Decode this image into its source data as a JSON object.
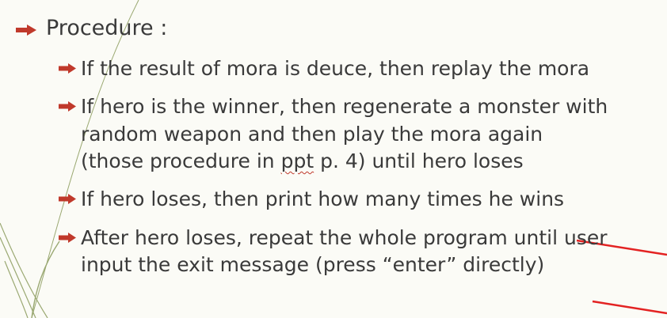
{
  "slide": {
    "heading": "Procedure :",
    "bullets": [
      {
        "lines": [
          "If the result of mora is deuce, then replay the mora"
        ]
      },
      {
        "lines": [
          "If hero is the winner, then regenerate a monster with",
          "random weapon and then play the mora again"
        ],
        "line3_pre": "(those procedure in ",
        "line3_marked": "ppt",
        "line3_post": " p. 4) until hero loses"
      },
      {
        "lines": [
          "If hero loses, then print how many times he wins"
        ]
      },
      {
        "lines": [
          "After hero loses, repeat the whole program until user",
          "input the exit message (press “enter” directly)"
        ]
      }
    ]
  },
  "colors": {
    "bullet": "#c0392b",
    "text": "#3a3a3a",
    "annotation": "#e32222",
    "background": "#fbfbf6",
    "decor_line": "#8a9a5b"
  },
  "icons": [
    "arrow-right-icon"
  ]
}
